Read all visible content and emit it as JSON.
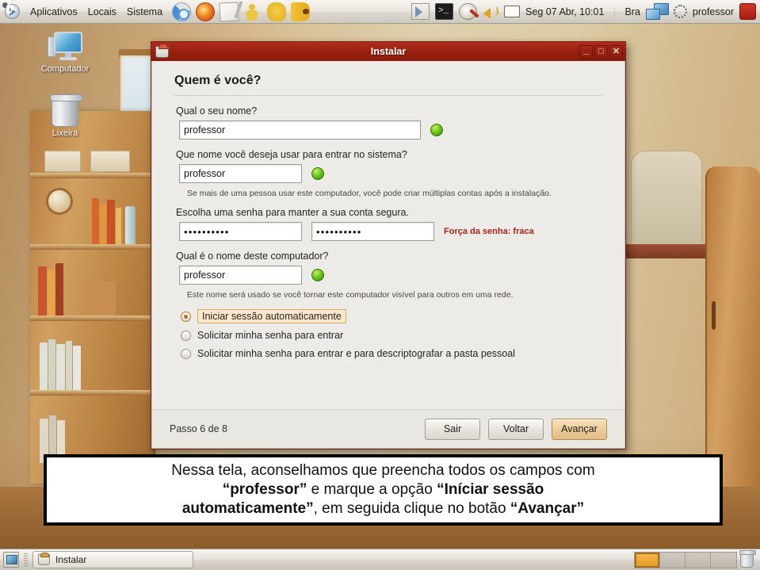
{
  "top_panel": {
    "logo_icon": "ubuntu-logo-icon",
    "menus": [
      "Aplicativos",
      "Locais",
      "Sistema"
    ],
    "launchers": [
      {
        "name": "chrome-icon"
      },
      {
        "name": "firefox-icon"
      },
      {
        "name": "notepad-icon"
      },
      {
        "name": "person-icon"
      },
      {
        "name": "hand-icon"
      },
      {
        "name": "paint-icon"
      }
    ],
    "tray": [
      {
        "name": "workspaces-icon"
      },
      {
        "name": "terminal-icon",
        "glyph": ">_"
      },
      {
        "name": "updates-icon"
      },
      {
        "name": "volume-icon"
      },
      {
        "name": "mail-icon"
      }
    ],
    "clock": "Seg 07 Abr, 10:01",
    "separator": "⋮",
    "keyboard_layout": "Bra",
    "network_icon": "network-monitor-icon",
    "user_status_icon": "user-status-icon",
    "username": "professor",
    "power_icon": "power-icon"
  },
  "desktop": {
    "icons": [
      {
        "name": "computer-icon",
        "label": "Computador"
      },
      {
        "name": "trash-icon",
        "label": "Lixeira"
      }
    ]
  },
  "installer": {
    "window_title": "Instalar",
    "title_icon": "installer-icon",
    "window_buttons": {
      "minimize": "_",
      "maximize": "□",
      "close": "✕"
    },
    "heading": "Quem é você?",
    "fields": {
      "fullname": {
        "label": "Qual o seu nome?",
        "value": "professor",
        "status_icon": "valid-green-dot"
      },
      "username": {
        "label": "Que nome você deseja usar para entrar no sistema?",
        "value": "professor",
        "status_icon": "valid-green-dot",
        "hint": "Se mais de uma pessoa usar este computador, você pode criar múltiplas contas após a instalação."
      },
      "password": {
        "label": "Escolha uma senha para manter a sua conta segura.",
        "value": "••••••••••",
        "confirm_value": "••••••••••",
        "strength": "Força da senha: fraca",
        "strength_color": "#a82218"
      },
      "hostname": {
        "label": "Qual é o nome deste computador?",
        "value": "professor",
        "status_icon": "valid-green-dot",
        "hint": "Este nome será usado se você tornar este computador visível para outros em uma rede."
      }
    },
    "login_options": [
      {
        "label": "Iniciar sessão automaticamente",
        "selected": true,
        "focused": true
      },
      {
        "label": "Solicitar minha senha para entrar",
        "selected": false,
        "focused": false
      },
      {
        "label": "Solicitar minha senha para entrar e para descriptografar a pasta pessoal",
        "selected": false,
        "focused": false
      }
    ],
    "footer": {
      "step": "Passo 6 de 8",
      "buttons": [
        {
          "name": "quit-button",
          "label": "Sair",
          "primary": false
        },
        {
          "name": "back-button",
          "label": "Voltar",
          "primary": false
        },
        {
          "name": "forward-button",
          "label": "Avançar",
          "primary": true
        }
      ]
    }
  },
  "caption": {
    "line1_a": "Nessa tela, aconselhamos que preencha todos os campos com",
    "line2_a": "“professor”",
    "line2_b": " e marque a opção ",
    "line2_c": "“Iníciar sessão",
    "line3_a": "automaticamente”",
    "line3_b": ", em seguida clique no botão ",
    "line3_c": "“Avançar”"
  },
  "bottom_panel": {
    "show_desktop_icon": "show-desktop-icon",
    "task": {
      "icon": "installer-icon",
      "label": "Instalar"
    },
    "workspaces": [
      {
        "active": true
      },
      {
        "active": false
      },
      {
        "active": false
      },
      {
        "active": false
      }
    ],
    "trash_icon": "trash-icon"
  },
  "colors": {
    "title_bar": "#99200f",
    "accent_orange": "#e39a22",
    "panel_bg": "#e9e6df",
    "dialog_bg": "#edebe7",
    "valid_green": "#5fbe12",
    "error_red": "#a82218"
  }
}
